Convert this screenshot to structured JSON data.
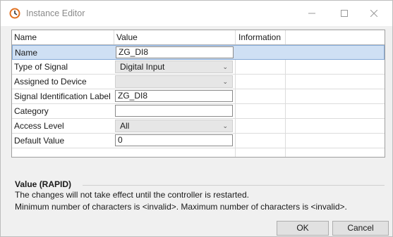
{
  "window": {
    "title": "Instance Editor",
    "icons": {
      "app": "abb-app-icon",
      "minimize": "minimize-icon",
      "maximize": "maximize-icon",
      "close": "close-icon"
    }
  },
  "grid": {
    "columns": [
      "Name",
      "Value",
      "Information"
    ],
    "rows": [
      {
        "label": "Name",
        "value": "ZG_DI8",
        "kind": "text",
        "selected": true
      },
      {
        "label": "Type of Signal",
        "value": "Digital Input",
        "kind": "combo"
      },
      {
        "label": "Assigned to Device",
        "value": "",
        "kind": "combo"
      },
      {
        "label": "Signal Identification Label",
        "value": "ZG_DI8",
        "kind": "text"
      },
      {
        "label": "Category",
        "value": "",
        "kind": "text"
      },
      {
        "label": "Access Level",
        "value": "All",
        "kind": "combo"
      },
      {
        "label": "Default Value",
        "value": "0",
        "kind": "text"
      }
    ]
  },
  "description": {
    "title": "Value (RAPID)",
    "line1": "The changes will not take effect until the controller is restarted.",
    "line2": "Minimum number of characters is <invalid>. Maximum number of characters is <invalid>."
  },
  "buttons": {
    "ok": "OK",
    "cancel": "Cancel"
  },
  "colors": {
    "selection": "#cfe0f4",
    "selection_border": "#84a9d7",
    "icon_accent": "#e07020"
  }
}
